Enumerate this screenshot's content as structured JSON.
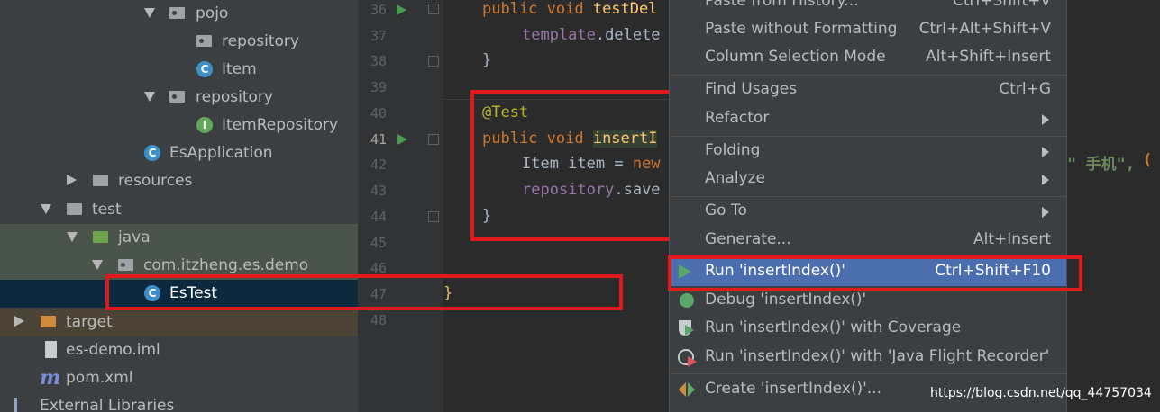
{
  "tree": {
    "items": [
      {
        "label": "pojo"
      },
      {
        "label": "repository"
      },
      {
        "label": "Item"
      },
      {
        "label": "repository"
      },
      {
        "label": "ItemRepository"
      },
      {
        "label": "EsApplication"
      },
      {
        "label": "resources"
      },
      {
        "label": "test"
      },
      {
        "label": "java"
      },
      {
        "label": "com.itzheng.es.demo"
      },
      {
        "label": "EsTest"
      },
      {
        "label": "target"
      },
      {
        "label": "es-demo.iml"
      },
      {
        "label": "pom.xml"
      },
      {
        "label": "External Libraries"
      }
    ],
    "icon_letters": {
      "class": "C",
      "interface": "I",
      "maven": "m"
    }
  },
  "editor": {
    "line_numbers": [
      "36",
      "37",
      "38",
      "39",
      "40",
      "41",
      "42",
      "43",
      "44",
      "45",
      "46",
      "47",
      "48"
    ],
    "code": {
      "l36_kw": "public void ",
      "l36_fn": "testDel",
      "l37_fld": "template",
      "l37_rest": ".delete",
      "l38": "}",
      "l40_ann": "@Test",
      "l41_kw": "public void ",
      "l41_fn": "insertI",
      "l42_type": "Item item = ",
      "l42_kw": "new",
      "l43_fld": "repository",
      "l43_rest": ".save",
      "l44": "}",
      "l47": "}"
    },
    "right_remnant": "\" 手机\",",
    "right_remnant2": "("
  },
  "menu": {
    "items": [
      {
        "label": "Paste from History...",
        "shortcut": "Ctrl+Shift+V"
      },
      {
        "label": "Paste without Formatting",
        "shortcut": "Ctrl+Alt+Shift+V"
      },
      {
        "label": "Column Selection Mode",
        "shortcut": "Alt+Shift+Insert"
      },
      {
        "label": "Find Usages",
        "shortcut": "Ctrl+G"
      },
      {
        "label": "Refactor",
        "shortcut": ""
      },
      {
        "label": "Folding",
        "shortcut": ""
      },
      {
        "label": "Analyze",
        "shortcut": ""
      },
      {
        "label": "Go To",
        "shortcut": ""
      },
      {
        "label": "Generate...",
        "shortcut": "Alt+Insert"
      },
      {
        "label": "Run 'insertIndex()'",
        "shortcut": "Ctrl+Shift+F10"
      },
      {
        "label": "Debug 'insertIndex()'",
        "shortcut": ""
      },
      {
        "label": "Run 'insertIndex()' with Coverage",
        "shortcut": ""
      },
      {
        "label": "Run 'insertIndex()' with 'Java Flight Recorder'",
        "shortcut": ""
      },
      {
        "label": "Create 'insertIndex()'...",
        "shortcut": ""
      }
    ]
  },
  "watermark": "https://blog.csdn.net/qq_44757034",
  "colors": {
    "accent": "#4b6eaf",
    "highlight_box": "#e0191d"
  }
}
